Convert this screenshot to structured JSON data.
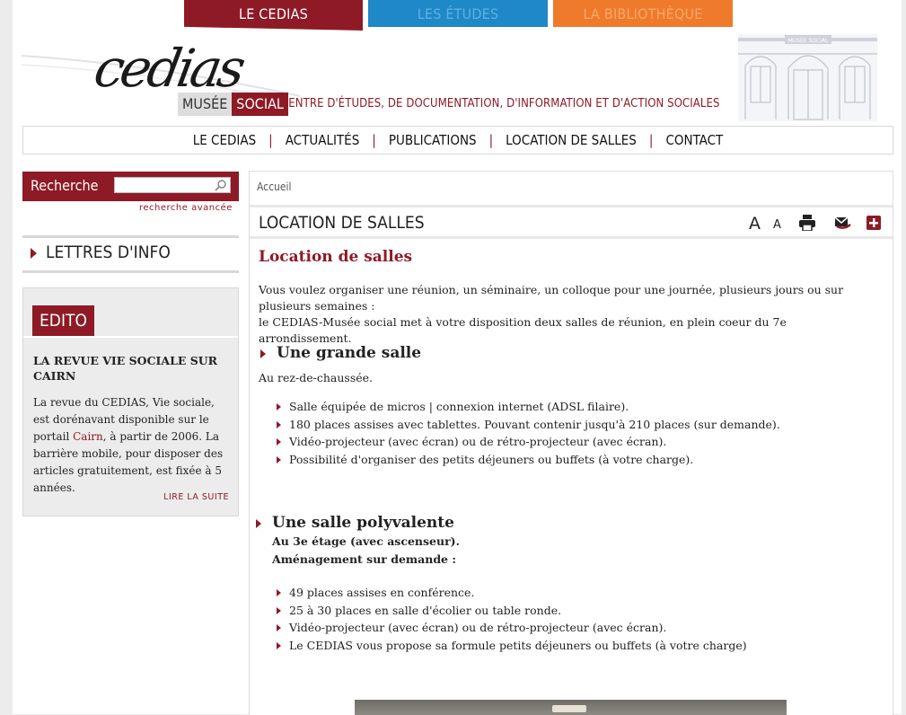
{
  "top_tabs": [
    {
      "label": "LE CEDIAS",
      "color": "#8e1a26"
    },
    {
      "label": "LES ÉTUDES",
      "color": "#1f88c6"
    },
    {
      "label": "LA BIBLIOTHÈQUE",
      "color": "#ef7a2c"
    }
  ],
  "header": {
    "logo_text": "cedias",
    "musee": "MUSÉE",
    "social": "SOCIAL",
    "tagline": "CENTRE D'ÉTUDES, DE DOCUMENTATION, D'INFORMATION ET D'ACTION SOCIALES",
    "building_sign": "MUSÉE SOCIAL"
  },
  "main_nav": {
    "items": [
      "LE CEDIAS",
      "ACTUALITÉS",
      "PUBLICATIONS",
      "LOCATION DE SALLES",
      "CONTACT"
    ],
    "separator": "|"
  },
  "sidebar": {
    "search_label": "Recherche",
    "search_value": "",
    "advanced_link": "recherche avancée",
    "newsletter": "LETTRES D'INFO",
    "edito": {
      "badge": "EDITO",
      "title": "LA REVUE VIE SOCIALE SUR CAIRN",
      "body_before_link": "La revue du CEDIAS, Vie sociale, est dorénavant disponible sur le portail ",
      "link": "Cairn",
      "body_after_link": ", à partir de 2006. La barrière mobile, pour disposer des articles gratuitement, est fixée à 5 années.",
      "read_more": "LIRE LA SUITE"
    }
  },
  "content": {
    "breadcrumb": "Accueil",
    "page_title": "LOCATION DE SALLES",
    "tools": {
      "font_larger": "A",
      "font_smaller": "A"
    },
    "heading": "Location de salles",
    "intro_1": "Vous voulez organiser une réunion, un séminaire, un colloque pour une journée, plusieurs jours ou sur plusieurs semaines :",
    "intro_2": "le CEDIAS-Musée social met à votre disposition deux salles de réunion, en plein coeur du 7e arrondissement.",
    "room1": {
      "title": "Une grande salle",
      "subtitle": "Au rez-de-chaussée.",
      "features": [
        "Salle équipée de micros | connexion internet (ADSL filaire).",
        "180 places assises avec tablettes. Pouvant contenir jusqu'à 210 places (sur demande).",
        "Vidéo-projecteur (avec écran) ou de rétro-projecteur (avec écran).",
        "Possibilité d'organiser des petits déjeuners ou buffets (à votre charge)."
      ]
    },
    "room2": {
      "title": "Une salle polyvalente",
      "line1": "Au 3e étage (avec ascenseur).",
      "line2": "Aménagement sur demande :",
      "features": [
        "49 places assises en conférence.",
        "25 à 30 places en salle d'écolier ou table ronde.",
        "Vidéo-projecteur (avec écran) ou de rétro-projecteur (avec écran).",
        "Le CEDIAS vous propose sa formule petits déjeuners ou buffets (à votre charge)"
      ]
    }
  }
}
